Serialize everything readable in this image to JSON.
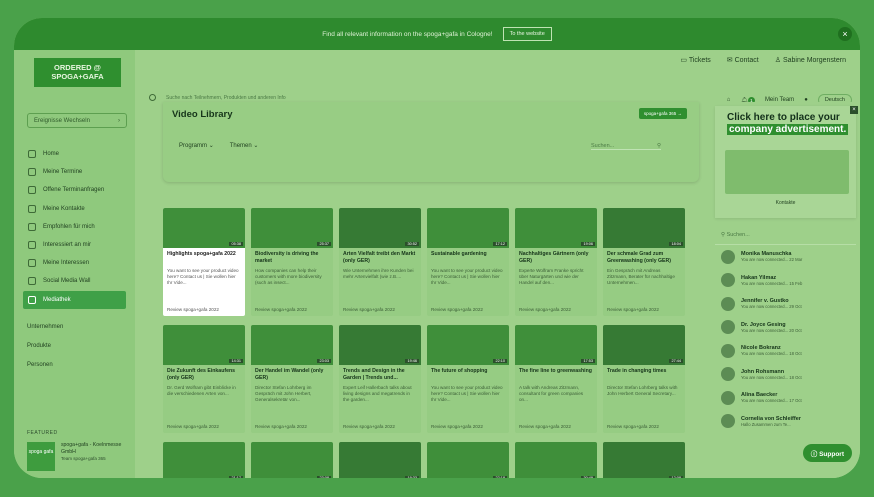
{
  "banner": {
    "text": "Find all relevant information on the spoga+gafa in Cologne!",
    "button": "To the website"
  },
  "sidebar": {
    "logo_line1": "ORDERED @",
    "logo_line2": "SPOGA+GAFA",
    "switch_label": "Ereignisse Wechseln",
    "nav": [
      {
        "label": "Home",
        "icon": "home-icon"
      },
      {
        "label": "Meine Termine",
        "icon": "calendar-icon"
      },
      {
        "label": "Offene Terminanfragen",
        "icon": "clock-icon"
      },
      {
        "label": "Meine Kontakte",
        "icon": "contacts-icon"
      },
      {
        "label": "Empfohlen für mich",
        "icon": "star-icon"
      },
      {
        "label": "Interessiert an mir",
        "icon": "smile-icon"
      },
      {
        "label": "Meine Interessen",
        "icon": "thumb-icon"
      },
      {
        "label": "Social Media Wall",
        "icon": "wall-icon"
      },
      {
        "label": "Mediathek",
        "icon": "media-icon"
      }
    ],
    "links": [
      "Unternehmen",
      "Produkte",
      "Personen"
    ],
    "featured_label": "FEATURED",
    "featured_name": "spoga+gafa - Koelnmesse GmbH",
    "featured_sub": "Team spoga+gafa 365",
    "featured_logo": "spoga gafa"
  },
  "top": {
    "tickets": "Tickets",
    "contact": "Contact",
    "user": "Sabine Morgenstern",
    "search_placeholder": "Suche nach Teilnehmern, Produkten und anderen Info",
    "team": "Mein Team",
    "lang": "Deutsch",
    "notif": "1"
  },
  "library": {
    "title": "Video Library",
    "btn": "spoga+gafa 365 →",
    "filter1": "Programm",
    "filter2": "Themen",
    "search": "Suchen..."
  },
  "videos": [
    {
      "title": "Highlights spoga+gafa 2022",
      "desc": "You want to see your product video here? Contact us | Sie wollen hier Ihr Vide...",
      "rev": "Review spoga+gafa 2022",
      "dur": "05:38"
    },
    {
      "title": "Biodiversity is driving the market",
      "desc": "How companies can help their customers with more biodiversity (such as insect...",
      "rev": "Review spoga+gafa 2022",
      "dur": "25:37"
    },
    {
      "title": "Arten Vielfalt treibt den Markt (only GER)",
      "desc": "Wie Unternehmen ihre Kunden bei mehr Artenvielfalt (wie z.B....",
      "rev": "Review spoga+gafa 2022",
      "dur": "30:52"
    },
    {
      "title": "Sustainable gardening",
      "desc": "You want to see your product video here? Contact us | Sie wollen hier Ihr Vide...",
      "rev": "Review spoga+gafa 2022",
      "dur": "17:12"
    },
    {
      "title": "Nachhaltiges Gärtnern (only GER)",
      "desc": "Experte Wolfram Franke spricht über Naturgärten und wie der Handel auf den...",
      "rev": "Review spoga+gafa 2022",
      "dur": "19:06"
    },
    {
      "title": "Der schmale Grad zum Greenwashing (only GER)",
      "desc": "Ein Gespräch mit Andreas Zitzmann, Berater für nachhaltige Unternehmen...",
      "rev": "Review spoga+gafa 2022",
      "dur": "18:04"
    },
    {
      "title": "Die Zukunft des Einkaufens (only GER)",
      "desc": "Dr. Gerd Wolfram gibt Einblicke in die verschiedenen Arten von...",
      "rev": "Review spoga+gafa 2022",
      "dur": "14:31"
    },
    {
      "title": "Der Handel im Wandel (only GER)",
      "desc": "Director Stefan Lohrberg im Gespräch mit John Herbert, Generalsekretär von...",
      "rev": "Review spoga+gafa 2022",
      "dur": "23:03"
    },
    {
      "title": "Trends and Design in the Garden | Trends und...",
      "desc": "Expert Leif Hallerbach talks about living designs and megatrends in the garden...",
      "rev": "Review spoga+gafa 2022",
      "dur": "19:46"
    },
    {
      "title": "The future of shopping",
      "desc": "You want to see your product video here? Contact us | Sie wollen hier Ihr Vide...",
      "rev": "Review spoga+gafa 2022",
      "dur": "22:10"
    },
    {
      "title": "The fine line to greenwashing",
      "desc": "A talk with Andreas Zitzmann, consultant for green companies on...",
      "rev": "Review spoga+gafa 2022",
      "dur": "17:53"
    },
    {
      "title": "Trade in changing times",
      "desc": "Director Stefan Lohrberg talks with John Herbert General Secretary...",
      "rev": "Review spoga+gafa 2022",
      "dur": "27:44"
    },
    {
      "title": "",
      "desc": "",
      "rev": "",
      "dur": "21:17"
    },
    {
      "title": "",
      "desc": "",
      "rev": "",
      "dur": "23:08"
    },
    {
      "title": "",
      "desc": "",
      "rev": "",
      "dur": "19:33"
    },
    {
      "title": "",
      "desc": "",
      "rev": "",
      "dur": "22:18"
    },
    {
      "title": "",
      "desc": "",
      "rev": "",
      "dur": "30:49"
    },
    {
      "title": "",
      "desc": "",
      "rev": "",
      "dur": "12:08"
    }
  ],
  "ad": {
    "line1": "Click here to place your",
    "line2": "company advertisement.",
    "label": "Kontakte"
  },
  "contacts": {
    "search": "Suchen...",
    "items": [
      {
        "name": "Monika Manuschka",
        "sub": "You are now connected... 22 Mar"
      },
      {
        "name": "Hakan Yilmaz",
        "sub": "You are now connected... 15 Feb"
      },
      {
        "name": "Jennifer v. Gustko",
        "sub": "You are now connected... 29 Oct"
      },
      {
        "name": "Dr. Joyce Gesing",
        "sub": "You are now connected... 20 Oct"
      },
      {
        "name": "Nicole Bokranz",
        "sub": "You are now connected... 18 Oct"
      },
      {
        "name": "John Rohsmann",
        "sub": "You are now connected... 18 Oct"
      },
      {
        "name": "Alina Baecker",
        "sub": "You are now connected... 17 Oct"
      },
      {
        "name": "Cornelia von Schleiffer",
        "sub": "Hallo Zusammen zum Te..."
      }
    ]
  },
  "support": "Support"
}
